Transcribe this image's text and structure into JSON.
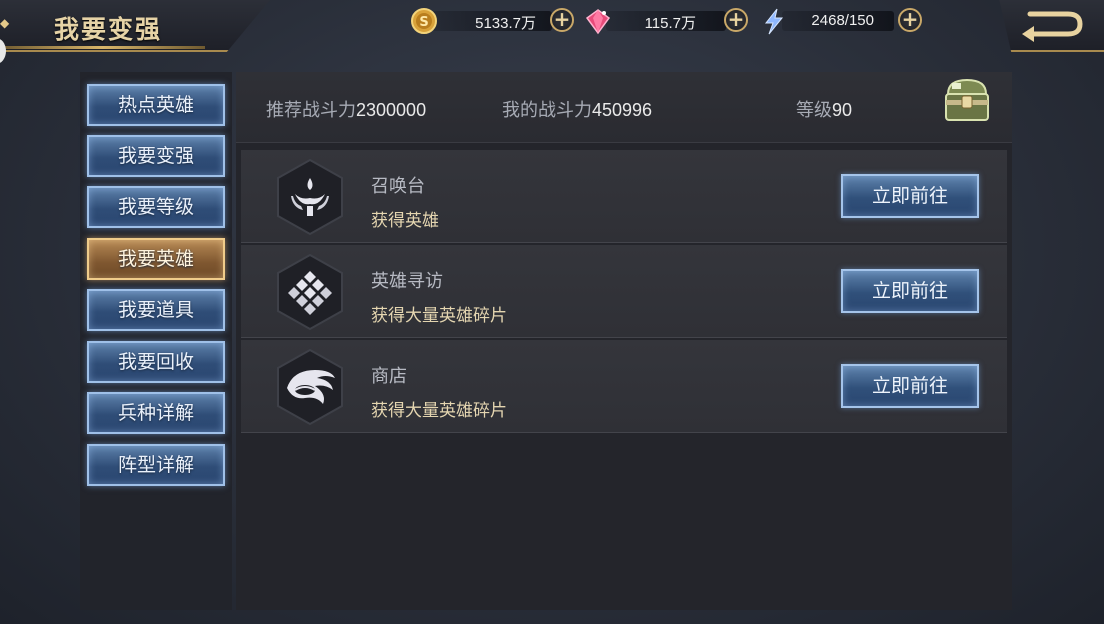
{
  "header": {
    "title": "我要变强",
    "resources": [
      {
        "name": "gold",
        "icon": "gold-coin-icon",
        "value": "5133.7万"
      },
      {
        "name": "gems",
        "icon": "red-gem-icon",
        "value": "115.7万"
      },
      {
        "name": "energy",
        "icon": "lightning-icon",
        "value": "2468/150"
      }
    ],
    "plus_symbol": "+",
    "back_icon": "back-arrow-icon"
  },
  "sidebar": {
    "items": [
      {
        "label": "热点英雄",
        "active": false
      },
      {
        "label": "我要变强",
        "active": false
      },
      {
        "label": "我要等级",
        "active": false
      },
      {
        "label": "我要英雄",
        "active": true
      },
      {
        "label": "我要道具",
        "active": false
      },
      {
        "label": "我要回收",
        "active": false
      },
      {
        "label": "兵种详解",
        "active": false
      },
      {
        "label": "阵型详解",
        "active": false
      }
    ]
  },
  "stats": {
    "recommended_label": "推荐战斗力",
    "recommended_value": "2300000",
    "my_power_label": "我的战斗力",
    "my_power_value": "450996",
    "level_label": "等级",
    "level_value": "90",
    "chest_icon": "treasure-chest-icon"
  },
  "entries": [
    {
      "title": "召唤台",
      "desc": "获得英雄",
      "icon": "summon-altar-icon",
      "button": "立即前往"
    },
    {
      "title": "英雄寻访",
      "desc": "获得大量英雄碎片",
      "icon": "diamond-grid-icon",
      "button": "立即前往"
    },
    {
      "title": "商店",
      "desc": "获得大量英雄碎片",
      "icon": "dragon-emblem-icon",
      "button": "立即前往"
    }
  ]
}
